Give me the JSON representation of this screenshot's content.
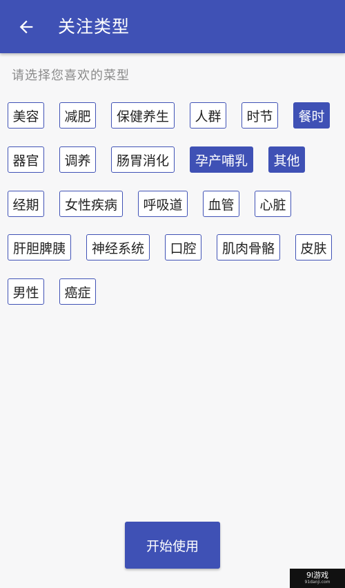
{
  "header": {
    "title": "关注类型",
    "back_icon": "arrow-back-icon",
    "background_color": "#3f51b5"
  },
  "prompt": "请选择您喜欢的菜型",
  "accent_color": "#3f51b5",
  "tags": [
    {
      "label": "美容",
      "selected": false
    },
    {
      "label": "减肥",
      "selected": false
    },
    {
      "label": "保健养生",
      "selected": false
    },
    {
      "label": "人群",
      "selected": false
    },
    {
      "label": "时节",
      "selected": false
    },
    {
      "label": "餐时",
      "selected": true
    },
    {
      "label": "器官",
      "selected": false
    },
    {
      "label": "调养",
      "selected": false
    },
    {
      "label": "肠胃消化",
      "selected": false
    },
    {
      "label": "孕产哺乳",
      "selected": true
    },
    {
      "label": "其他",
      "selected": true
    },
    {
      "label": "经期",
      "selected": false
    },
    {
      "label": "女性疾病",
      "selected": false
    },
    {
      "label": "呼吸道",
      "selected": false
    },
    {
      "label": "血管",
      "selected": false
    },
    {
      "label": "心脏",
      "selected": false
    },
    {
      "label": "肝胆脾胰",
      "selected": false
    },
    {
      "label": "神经系统",
      "selected": false
    },
    {
      "label": "口腔",
      "selected": false
    },
    {
      "label": "肌肉骨骼",
      "selected": false
    },
    {
      "label": "皮肤",
      "selected": false
    },
    {
      "label": "男性",
      "selected": false
    },
    {
      "label": "癌症",
      "selected": false
    }
  ],
  "start_button": "开始使用",
  "watermark": {
    "main": "9l游戏",
    "sub": "91danji.com"
  }
}
